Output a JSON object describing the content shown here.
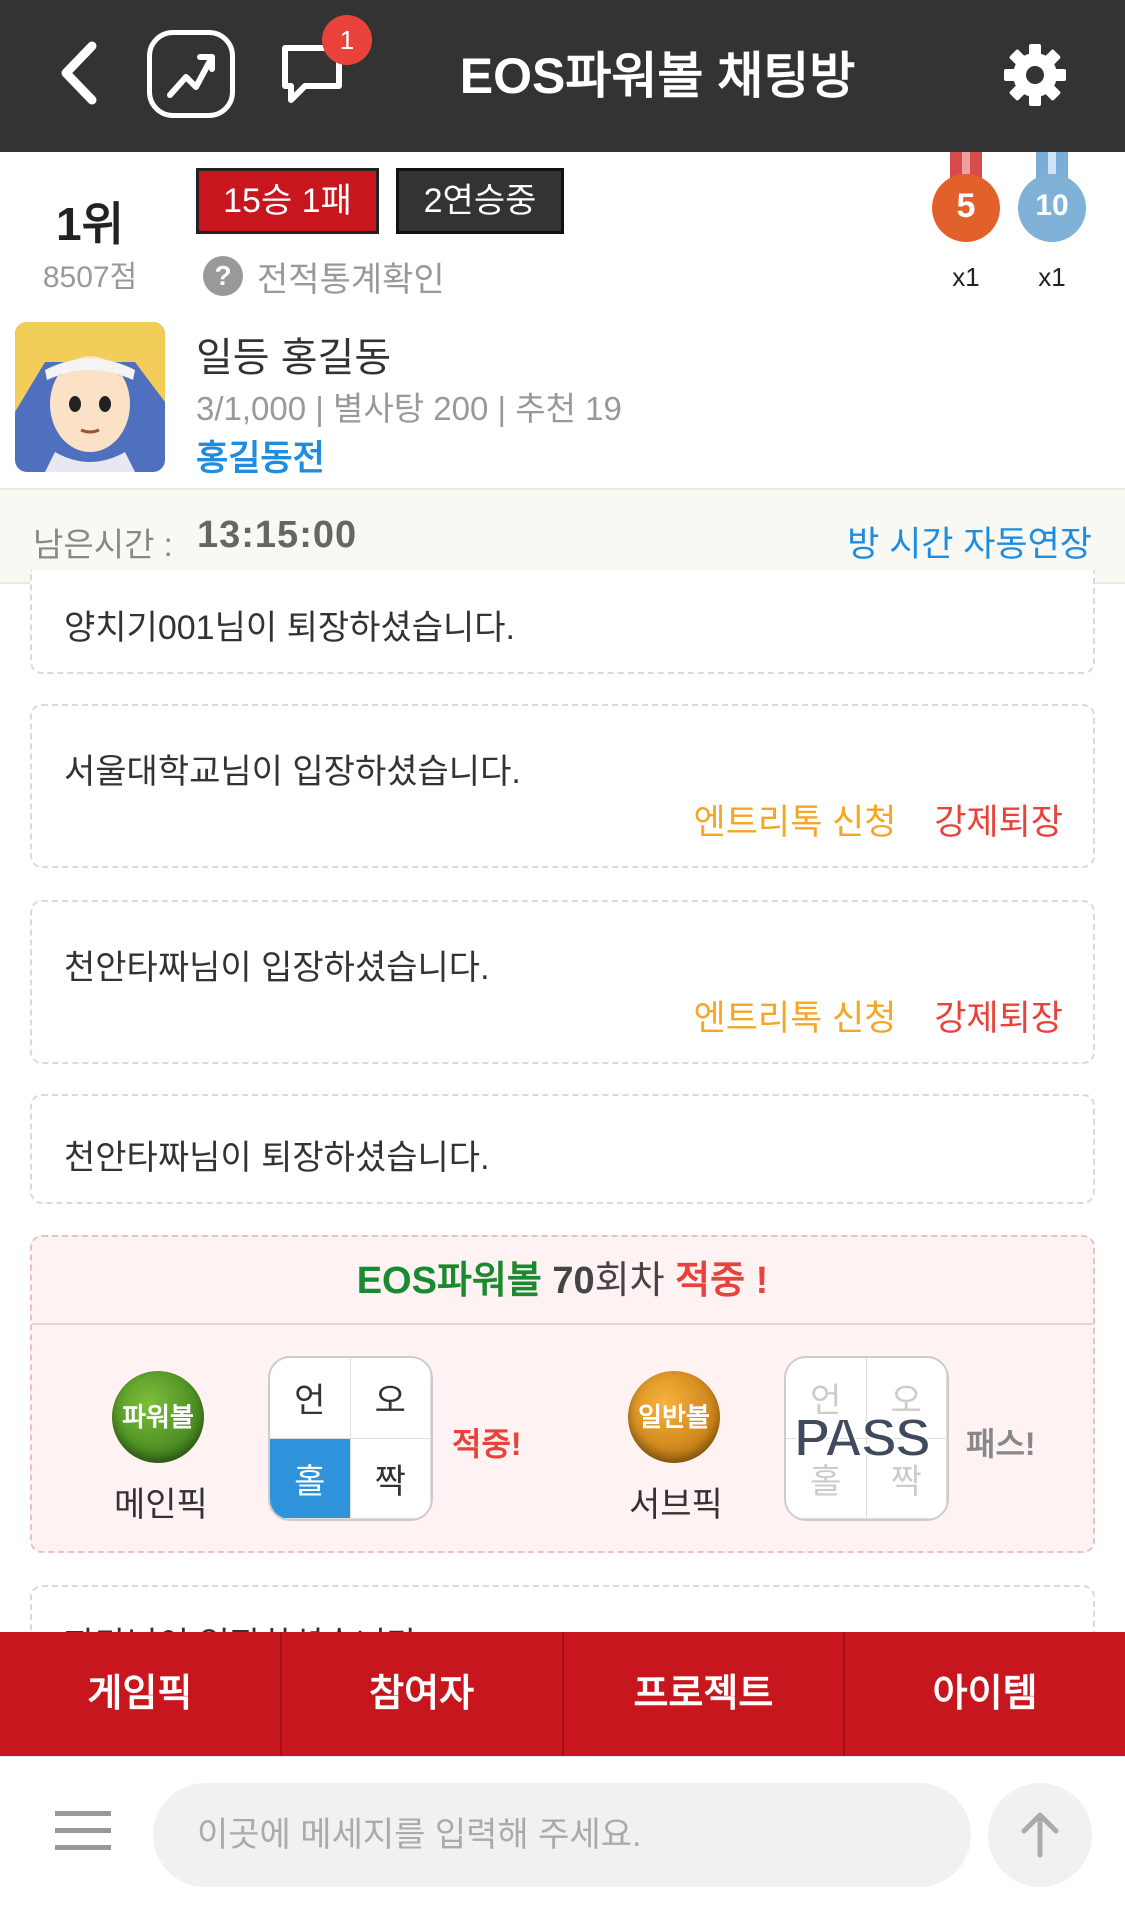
{
  "header": {
    "title": "EOS파워볼 채팅방",
    "notification_count": "1",
    "icons": [
      "back-icon",
      "stats-icon",
      "chat-bubble-icon",
      "gear-icon"
    ]
  },
  "profile": {
    "rank": "1위",
    "points": "8507점",
    "record": "15승 1패",
    "streak": "2연승중",
    "stats_link": "전적통계확인",
    "medals": [
      {
        "level": "5",
        "count": "x1",
        "color": "#e2602a"
      },
      {
        "level": "10",
        "count": "x1",
        "color": "#7fb2d6"
      }
    ],
    "nickname": "일등 홍길동",
    "meta": "3/1,000 | 별사탕 200 | 추천 19",
    "clan": "홍길동전"
  },
  "timer": {
    "label": "남은시간 :",
    "value": "13:15:00",
    "auto_extend": "방 시간 자동연장"
  },
  "messages": [
    {
      "text": "양치기001님이 퇴장하셨습니다."
    },
    {
      "text": "서울대학교님이 입장하셨습니다.",
      "entry": "엔트리톡 신청",
      "kick": "강제퇴장"
    },
    {
      "text": "천안타짜님이 입장하셨습니다.",
      "entry": "엔트리톡 신청",
      "kick": "강제퇴장"
    },
    {
      "text": "천안타짜님이 퇴장하셨습니다."
    }
  ],
  "result": {
    "game": "EOS파워볼",
    "round_num": "70",
    "round_suffix": "회차",
    "hit": "적중 !",
    "main_pick": {
      "ball": "파워볼",
      "label": "메인픽",
      "cells": [
        "언",
        "오",
        "홀",
        "짝"
      ],
      "selected": "홀",
      "verdict": "적중!"
    },
    "sub_pick": {
      "ball": "일반볼",
      "label": "서브픽",
      "cells": [
        "언",
        "오",
        "홀",
        "짝"
      ],
      "overlay": "PASS",
      "verdict": "패스!"
    }
  },
  "partial_message": "파라님이 입장하셨습니다.",
  "tabs": [
    "게임픽",
    "참여자",
    "프로젝트",
    "아이템"
  ],
  "input": {
    "placeholder": "이곳에 메세지를 입력해 주세요."
  },
  "colors": {
    "header_bg": "#333333",
    "accent_red": "#c8161f",
    "link_blue": "#1e8de0",
    "hit_green": "#1a8a2e",
    "warn_orange": "#f5a623"
  }
}
